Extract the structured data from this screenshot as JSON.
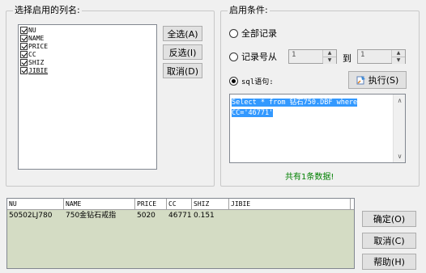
{
  "select_columns": {
    "title": "选择启用的列名:",
    "fields": [
      {
        "name": "NU",
        "checked": true
      },
      {
        "name": "NAME",
        "checked": true
      },
      {
        "name": "PRICE",
        "checked": true
      },
      {
        "name": "CC",
        "checked": true
      },
      {
        "name": "SHIZ",
        "checked": true
      },
      {
        "name": "JIBIE",
        "checked": true
      }
    ],
    "select_all_label": "全选(A)",
    "invert_label": "反选(I)",
    "cancel_label": "取消(D)"
  },
  "conditions": {
    "title": "启用条件:",
    "all_records_label": "全部记录",
    "record_range_label": "记录号从",
    "range_from_value": "1",
    "range_to_label": "到",
    "range_to_value": "1",
    "sql_label": "sql语句:",
    "execute_label": "执行(S)",
    "sql_text": "Select * from 钻石750.DBF where CC='46771'",
    "selected_option": "sql",
    "status_text": "共有1条数据!",
    "status_color": "#008000"
  },
  "results": {
    "columns": [
      "NU",
      "NAME",
      "PRICE",
      "CC",
      "SHIZ",
      "JIBIE"
    ],
    "rows": [
      [
        "50502LJ780",
        "750金钻石戒指",
        "5020",
        "46771",
        "0.151",
        ""
      ]
    ],
    "background_color": "#d4dcc4"
  },
  "actions": {
    "ok_label": "确定(O)",
    "cancel_label": "取消(C)",
    "help_label": "帮助(H)"
  }
}
